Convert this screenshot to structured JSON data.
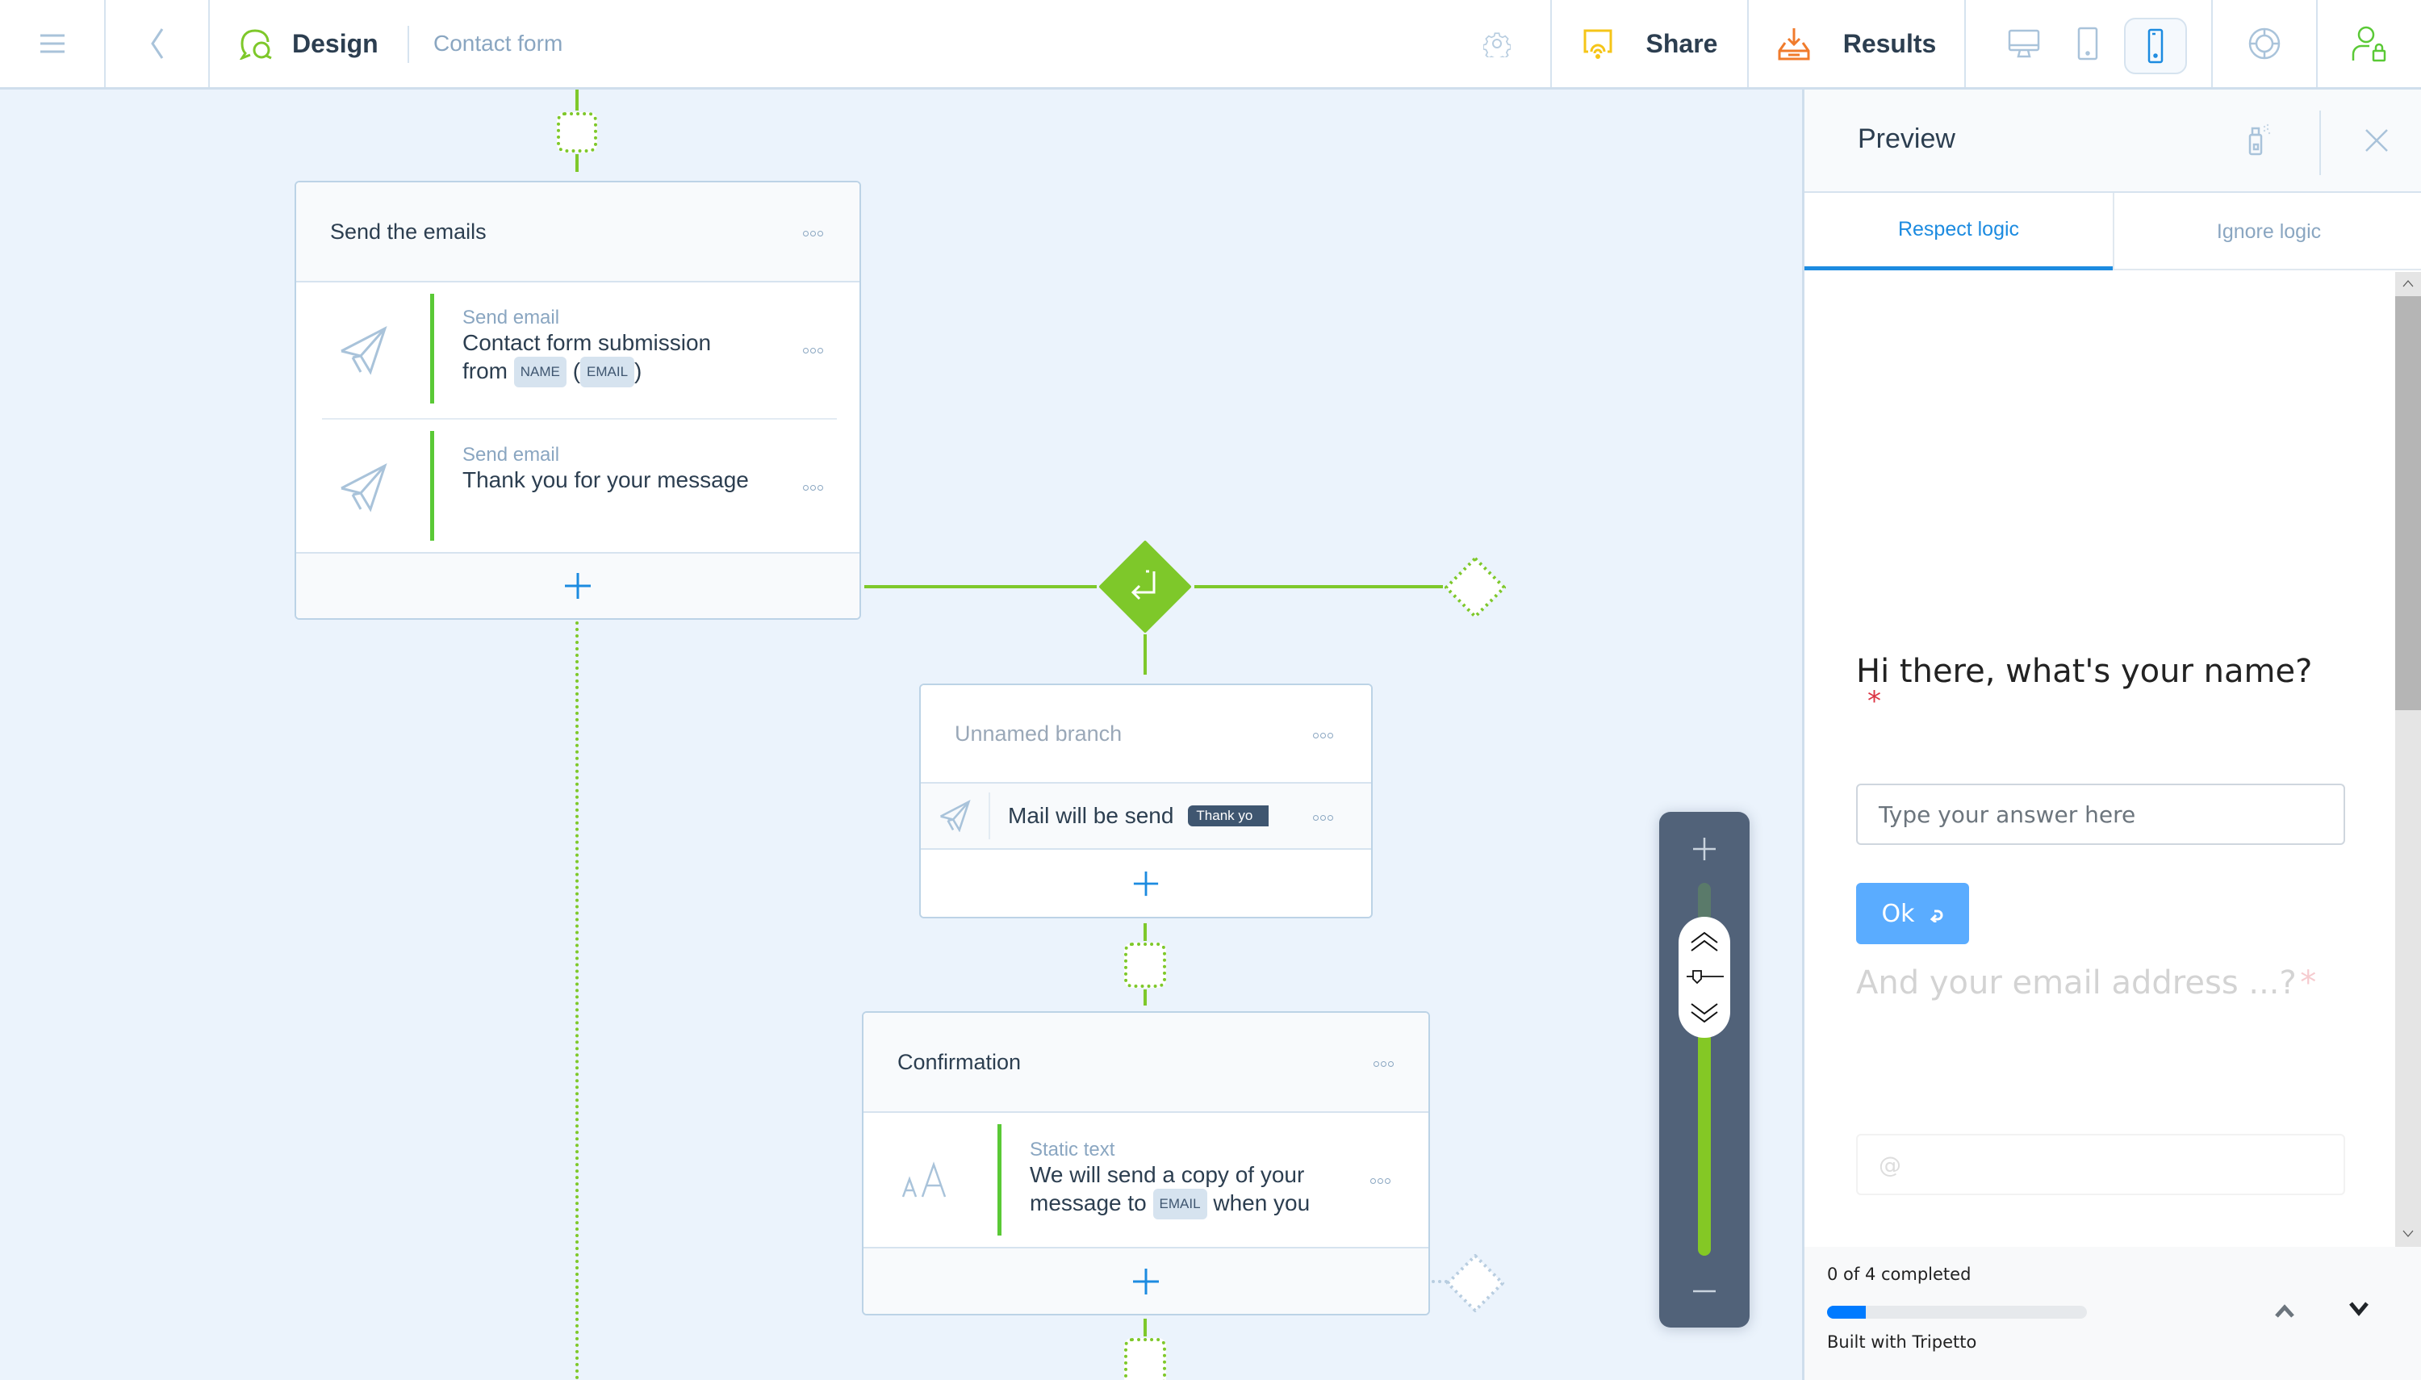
{
  "header": {
    "menu_icon": "hamburger-icon",
    "back_icon": "chevron-left-icon",
    "design_label": "Design",
    "form_name": "Contact form",
    "settings_icon": "gear-icon",
    "share_label": "Share",
    "results_label": "Results",
    "devices": [
      {
        "name": "desktop",
        "active": false
      },
      {
        "name": "tablet",
        "active": false
      },
      {
        "name": "phone",
        "active": true
      }
    ],
    "help_icon": "lifebuoy-icon",
    "account_icon": "user-lock-icon",
    "colors": {
      "design": "#7ec82a",
      "share": "#f5c518",
      "results": "#f07b2c",
      "active_device": "#1c8be0"
    }
  },
  "canvas": {
    "cluster_send_emails": {
      "title": "Send the emails",
      "items": [
        {
          "kind": "Send email",
          "text_before": "Contact form submission from",
          "chip1": "NAME",
          "paren_open": "(",
          "chip2": "EMAIL",
          "paren_close": ")"
        },
        {
          "kind": "Send email",
          "text": "Thank you for your message"
        }
      ]
    },
    "branch": {
      "title": "Unnamed branch",
      "item_text": "Mail will be send",
      "item_chip": "Thank yo"
    },
    "cluster_confirmation": {
      "title": "Confirmation",
      "item": {
        "kind": "Static text",
        "line1": "We will send a copy of your",
        "line2_before": "message to",
        "chip": "EMAIL",
        "line2_after": "when you"
      }
    },
    "zoom_level_fraction": 0.78
  },
  "preview": {
    "title": "Preview",
    "tabs": [
      {
        "label": "Respect logic",
        "active": true
      },
      {
        "label": "Ignore logic",
        "active": false
      }
    ],
    "question1": {
      "title": "Hi there, what's your name?",
      "required_mark": "*",
      "placeholder": "Type your answer here",
      "ok_label": "Ok"
    },
    "question2": {
      "title": "And your email address ...?",
      "required_mark": "*",
      "placeholder": "@"
    },
    "footer": {
      "progress_text": "0 of 4 completed",
      "progress_fraction": 0.15,
      "branding": "Built with Tripetto"
    }
  }
}
